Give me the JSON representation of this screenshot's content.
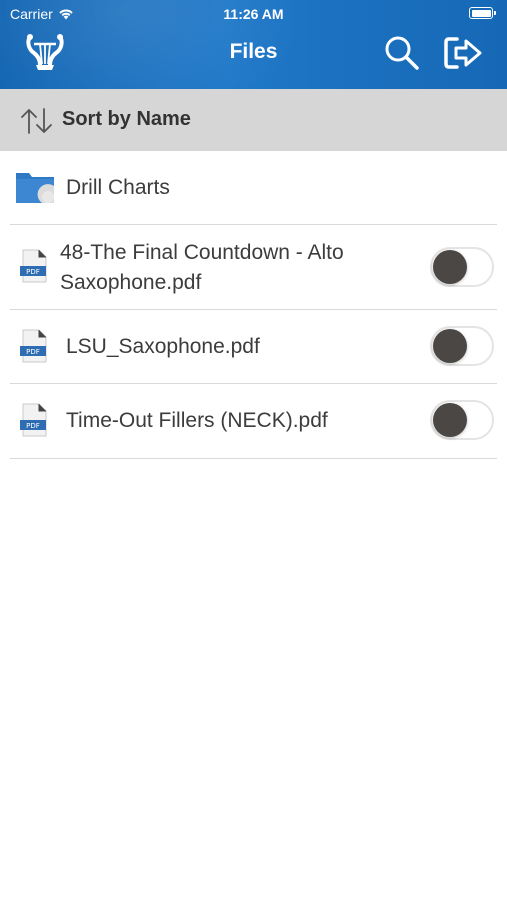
{
  "status_bar": {
    "carrier": "Carrier",
    "time": "11:26 AM",
    "wifi_icon": "wifi-icon",
    "battery_icon": "battery-icon"
  },
  "header": {
    "title": "Files",
    "logo_icon": "lyre-icon",
    "search_icon": "search-icon",
    "logout_icon": "logout-icon",
    "color_primary": "#1a6fbe"
  },
  "sort": {
    "label": "Sort by Name",
    "icon": "sort-arrows-icon",
    "background": "#d6d6d6"
  },
  "files": [
    {
      "type": "folder",
      "name": "Drill Charts"
    },
    {
      "type": "pdf",
      "name_line1": " 48-The Final Countdown - Alto",
      "name_line2": "Saxophone.pdf",
      "toggle_on": false
    },
    {
      "type": "pdf",
      "name": "LSU_Saxophone.pdf",
      "toggle_on": false
    },
    {
      "type": "pdf",
      "name": "Time-Out Fillers (NECK).pdf",
      "toggle_on": false
    }
  ],
  "pdf_badge_text": "PDF"
}
